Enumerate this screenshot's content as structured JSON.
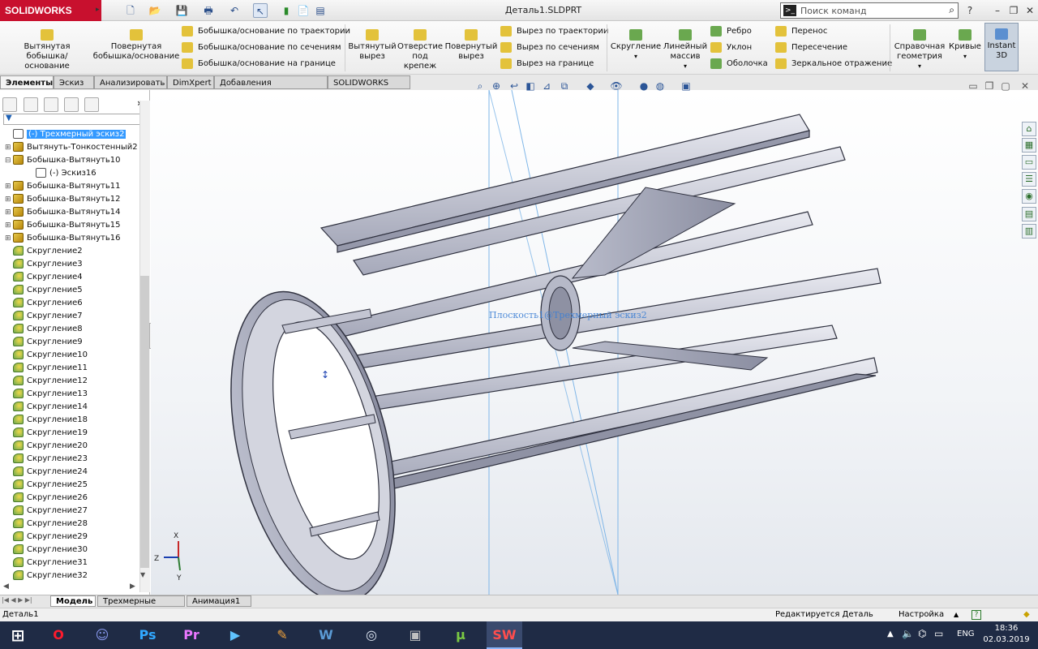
{
  "app": {
    "logo_text": "SOLIDWORKS",
    "document_title": "Деталь1.SLDPRT"
  },
  "search": {
    "placeholder": "Поиск команд"
  },
  "command_manager": {
    "big_buttons": [
      "Вытянутая бобышка/основание",
      "Повернутая бобышка/основание",
      "Вытянутый вырез",
      "Отверстие под крепеж",
      "Повернутый вырез",
      "Скругление",
      "Линейный массив",
      "Справочная геометрия",
      "Кривые",
      "Instant 3D"
    ],
    "boss_group": [
      "Бобышка/основание по траектории",
      "Бобышка/основание по сечениям",
      "Бобышка/основание на границе"
    ],
    "cut_group": [
      "Вырез по траектории",
      "Вырез по сечениям",
      "Вырез на границе"
    ],
    "feature_group": [
      "Ребро",
      "Уклон",
      "Оболочка"
    ],
    "transform_group": [
      "Перенос",
      "Пересечение",
      "Зеркальное отражение"
    ]
  },
  "tabs": [
    "Элементы",
    "Эскиз",
    "Анализировать",
    "DimXpert",
    "Добавления SOLIDWORKS",
    "SOLIDWORKS MBD"
  ],
  "active_tab": "Элементы",
  "feature_tree": [
    {
      "label": "(-) Трехмерный эскиз2",
      "type": "sketch3d",
      "selected": true
    },
    {
      "label": "Вытянуть-Тонкостенный2",
      "type": "extrude"
    },
    {
      "label": "Бобышка-Вытянуть10",
      "type": "extrude",
      "expanded": true
    },
    {
      "label": "(-) Эскиз16",
      "type": "sketch",
      "child": true
    },
    {
      "label": "Бобышка-Вытянуть11",
      "type": "extrude"
    },
    {
      "label": "Бобышка-Вытянуть12",
      "type": "extrude"
    },
    {
      "label": "Бобышка-Вытянуть14",
      "type": "extrude"
    },
    {
      "label": "Бобышка-Вытянуть15",
      "type": "extrude"
    },
    {
      "label": "Бобышка-Вытянуть16",
      "type": "extrude"
    },
    {
      "label": "Скругление2",
      "type": "fillet"
    },
    {
      "label": "Скругление3",
      "type": "fillet"
    },
    {
      "label": "Скругление4",
      "type": "fillet"
    },
    {
      "label": "Скругление5",
      "type": "fillet"
    },
    {
      "label": "Скругление6",
      "type": "fillet"
    },
    {
      "label": "Скругление7",
      "type": "fillet"
    },
    {
      "label": "Скругление8",
      "type": "fillet"
    },
    {
      "label": "Скругление9",
      "type": "fillet"
    },
    {
      "label": "Скругление10",
      "type": "fillet"
    },
    {
      "label": "Скругление11",
      "type": "fillet"
    },
    {
      "label": "Скругление12",
      "type": "fillet"
    },
    {
      "label": "Скругление13",
      "type": "fillet"
    },
    {
      "label": "Скругление14",
      "type": "fillet"
    },
    {
      "label": "Скругление18",
      "type": "fillet"
    },
    {
      "label": "Скругление19",
      "type": "fillet"
    },
    {
      "label": "Скругление20",
      "type": "fillet"
    },
    {
      "label": "Скругление23",
      "type": "fillet"
    },
    {
      "label": "Скругление24",
      "type": "fillet"
    },
    {
      "label": "Скругление25",
      "type": "fillet"
    },
    {
      "label": "Скругление26",
      "type": "fillet"
    },
    {
      "label": "Скругление27",
      "type": "fillet"
    },
    {
      "label": "Скругление28",
      "type": "fillet"
    },
    {
      "label": "Скругление29",
      "type": "fillet"
    },
    {
      "label": "Скругление30",
      "type": "fillet"
    },
    {
      "label": "Скругление31",
      "type": "fillet"
    },
    {
      "label": "Скругление32",
      "type": "fillet"
    }
  ],
  "viewport": {
    "plane_label": "Плоскость1@Трехмерный эскиз2",
    "triad": {
      "x": "X",
      "y": "Y",
      "z": "Z"
    }
  },
  "bottom_tabs": [
    "Модель",
    "Трехмерные виды",
    "Анимация1"
  ],
  "status": {
    "left": "Деталь1",
    "edit": "Редактируется Деталь",
    "settings": "Настройка",
    "help": "?"
  },
  "taskbar": {
    "apps": [
      "Windows",
      "Opera",
      "Discord",
      "Photoshop",
      "Premiere",
      "Movie",
      "Paint",
      "Word",
      "Steam",
      "Media",
      "uTorrent",
      "SOLIDWORKS"
    ],
    "lang": "ENG",
    "time": "18:36",
    "date": "02.03.2019"
  },
  "colors": {
    "accent": "#c8102e",
    "selection": "#3399ff",
    "taskbar": "#1f2b45",
    "part": "#c9cbd6"
  }
}
